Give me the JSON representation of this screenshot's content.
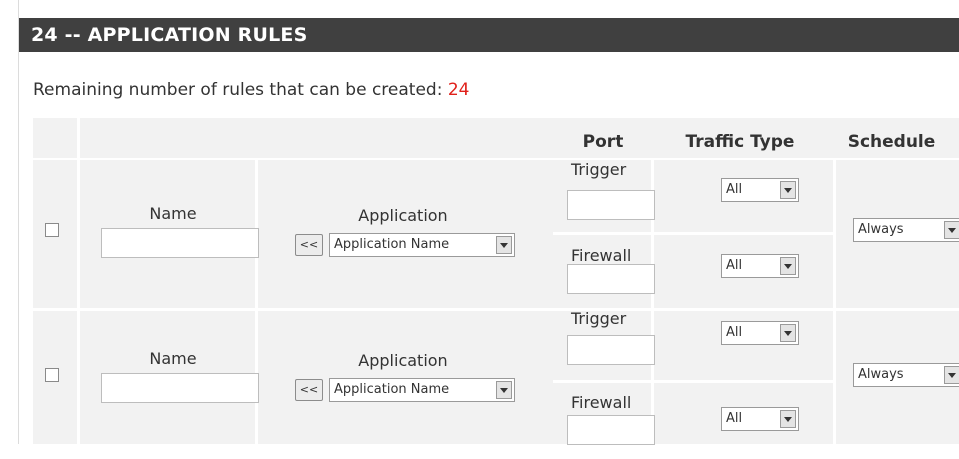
{
  "section": {
    "title": "24 -- APPLICATION RULES",
    "remaining_label": "Remaining number of rules that can be created:",
    "remaining_count": "24"
  },
  "table": {
    "headers": {
      "port": "Port",
      "traffic_type": "Traffic Type",
      "schedule": "Schedule"
    }
  },
  "rules": [
    {
      "name_label": "Name",
      "name_value": "",
      "application_label": "Application",
      "copy_button": "<<",
      "application_select": "Application Name",
      "trigger_label": "Trigger",
      "trigger_value": "",
      "firewall_label": "Firewall",
      "firewall_value": "",
      "trigger_traffic": "All",
      "firewall_traffic": "All",
      "schedule": "Always"
    },
    {
      "name_label": "Name",
      "name_value": "",
      "application_label": "Application",
      "copy_button": "<<",
      "application_select": "Application Name",
      "trigger_label": "Trigger",
      "trigger_value": "",
      "firewall_label": "Firewall",
      "firewall_value": "",
      "trigger_traffic": "All",
      "firewall_traffic": "All",
      "schedule": "Always"
    }
  ],
  "colors": {
    "title_bar": "#404040",
    "count_accent": "#e0201a",
    "table_bg": "#f2f2f2"
  }
}
